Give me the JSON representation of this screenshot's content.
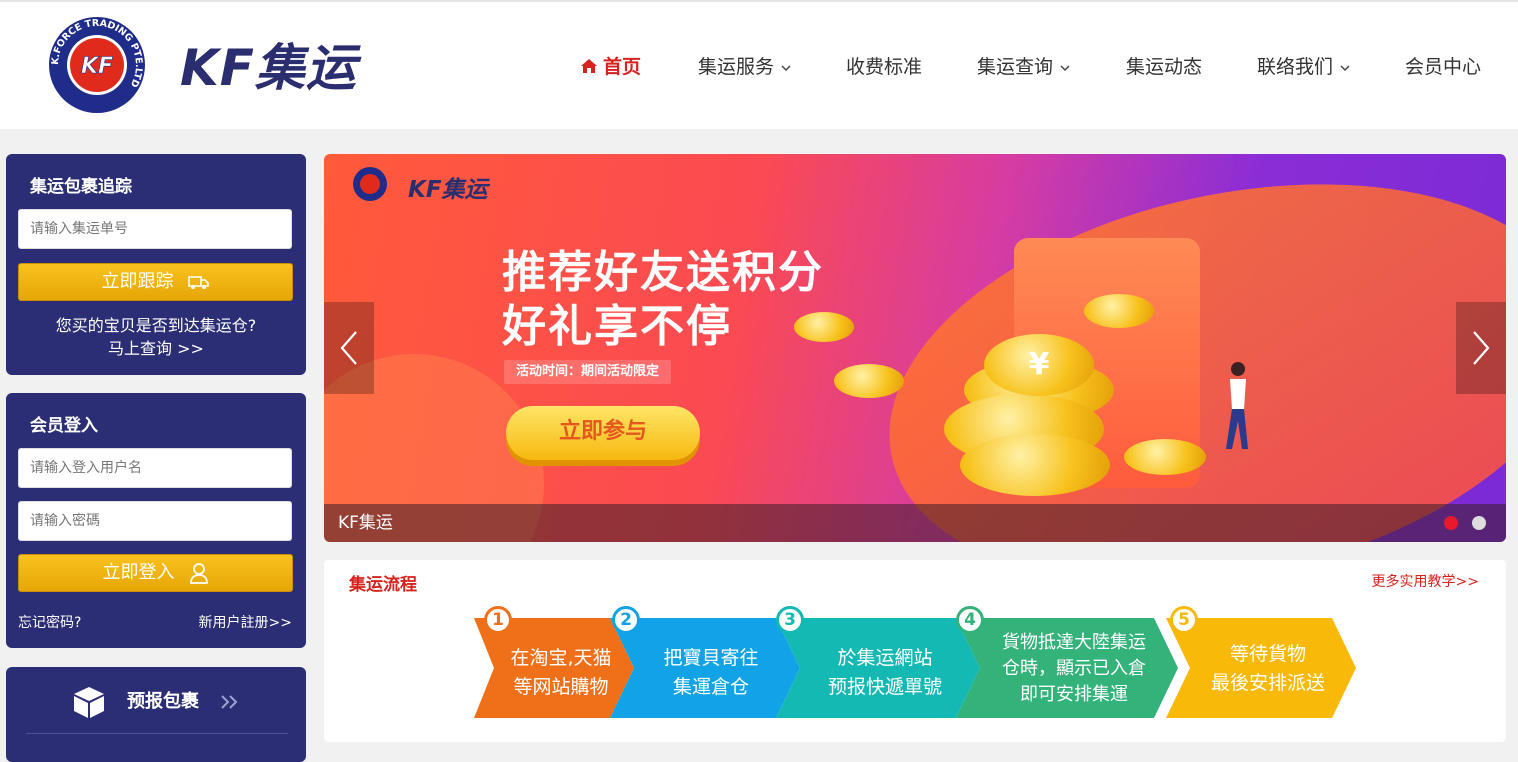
{
  "header": {
    "logo_text": "KF集运",
    "badge_text": "K.FORCE TRADING PTE.LTD",
    "badge_mark": "KF",
    "nav": [
      {
        "label": "首页",
        "active": true,
        "has_caret": false
      },
      {
        "label": "集运服务",
        "active": false,
        "has_caret": true
      },
      {
        "label": "收费标准",
        "active": false,
        "has_caret": false
      },
      {
        "label": "集运查询",
        "active": false,
        "has_caret": true
      },
      {
        "label": "集运动态",
        "active": false,
        "has_caret": false
      },
      {
        "label": "联络我们",
        "active": false,
        "has_caret": true
      },
      {
        "label": "会员中心",
        "active": false,
        "has_caret": false
      }
    ]
  },
  "tracking": {
    "title": "集运包裹追踪",
    "placeholder": "请输入集运单号",
    "button": "立即跟踪",
    "note_line1": "您买的宝贝是否到达集运仓?",
    "note_line2": "马上查询 >>"
  },
  "login": {
    "title": "会员登入",
    "username_placeholder": "请输入登入用户名",
    "password_placeholder": "请输入密碼",
    "button": "立即登入",
    "forgot": "忘记密码?",
    "register": "新用户註册>>"
  },
  "prereport": {
    "label": "预报包裹"
  },
  "banner": {
    "logo_text": "KF集运",
    "headline_line1": "推荐好友送积分",
    "headline_line2": "好礼享不停",
    "time_label": "活动时间：期间活动限定",
    "cta": "立即参与",
    "caption": "KF集运",
    "coin_symbol": "¥",
    "slides_total": 2,
    "active_slide": 1
  },
  "process": {
    "title": "集运流程",
    "more_link": "更多实用教学>>",
    "steps": [
      {
        "num": "1",
        "line1": "在淘宝,天猫",
        "line2": "等网站購物",
        "color": "#f07019"
      },
      {
        "num": "2",
        "line1": "把寶貝寄往",
        "line2": "集運倉仓",
        "color": "#12a3e6"
      },
      {
        "num": "3",
        "line1": "於集运網站",
        "line2": "预报快遞單號",
        "color": "#15b9b3"
      },
      {
        "num": "4",
        "line1": "貨物抵達大陸集运",
        "line2": "仓時，顯示已入倉",
        "line3": "即可安排集運",
        "color": "#33b27a"
      },
      {
        "num": "5",
        "line1": "等待貨物",
        "line2": "最後安排派送",
        "color": "#f9b908"
      }
    ]
  },
  "colors": {
    "brand_navy": "#2b2e75",
    "brand_red": "#d7231e",
    "button_gold": "#f2b311"
  }
}
